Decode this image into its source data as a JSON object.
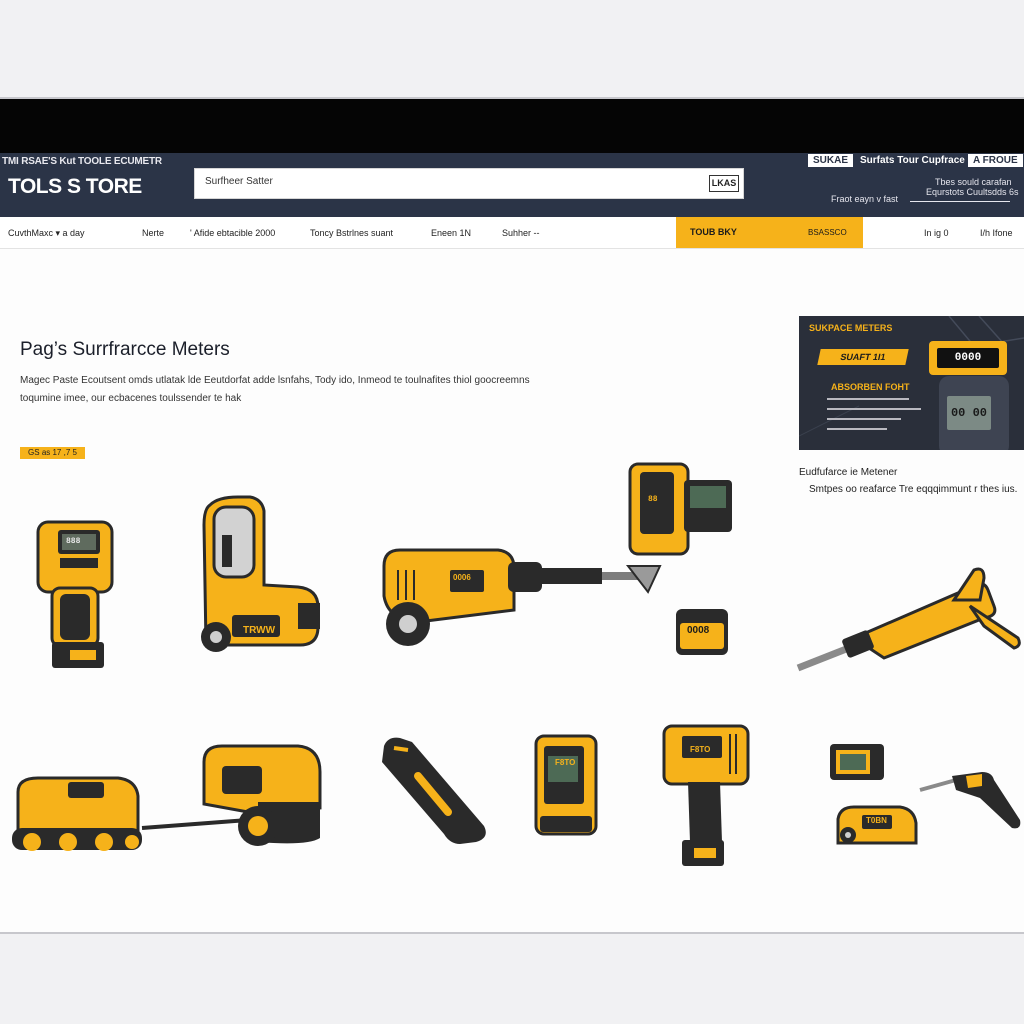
{
  "store": {
    "tagline": "TMI RSAE'S Kut TOOLE ECUMETR",
    "logo": "TOLS S TORE"
  },
  "search": {
    "value": "Surfheer Satter",
    "button_label": "LKAS"
  },
  "header_right": {
    "pill_label": "SUKAE",
    "title": "Surfats Tour Cupfrace",
    "pill2_label": "A FROUE",
    "left_sub": "Fraot eayn v fast",
    "right_sub_1": "Tbes sould carafan",
    "right_sub_2": "Equrstots Cuultsdds 6s"
  },
  "nav": {
    "items": [
      "CuvthMaxc  ▾  a   day",
      "Nerte",
      "' Afide  ebtacible  2000",
      "Toncy  Bstrlnes suant",
      "Eneen  1N",
      "Suhher  --"
    ],
    "cta_label": "TOUB BKY",
    "cta_sub": "BSASSCO",
    "right_items": [
      "In  ig   0",
      "I/h  Ifone"
    ]
  },
  "main": {
    "title": "Pag’s Surrfrarcce Meters",
    "description_line1": "Magec Paste Ecoutsent omds utlatak lde Eeutdorfat adde lsnfahs, Tody ido, Inmeod te toulnafites thiol goocreemns",
    "description_line2": "toqumine imee, our ecbacenes toulssender te hak",
    "price_label": "GS  as  17  ,7  5"
  },
  "promo": {
    "title": "SUKPACE METERS",
    "tag_label": "SUAFT 1I1",
    "display_value": "0000",
    "subtitle": "ABSORBEN FOHT",
    "screen_value": "00 00"
  },
  "side": {
    "title": "Eudfufarce ie Metener",
    "description": "Smtpes oo reafarce Tre eqqqimmunt r thes ius."
  },
  "products": {
    "labels": [
      "TRWW",
      "0006",
      "0008",
      "F8TO",
      "F8TO",
      "T0BN"
    ],
    "display_values": [
      "888",
      "88",
      "00",
      "888"
    ]
  },
  "colors": {
    "accent": "#f6b21a",
    "header_bg": "#2b3447",
    "promo_bg": "#2a2f3a",
    "tool_body": "#f6b21a",
    "tool_dark": "#2a2a2a"
  }
}
